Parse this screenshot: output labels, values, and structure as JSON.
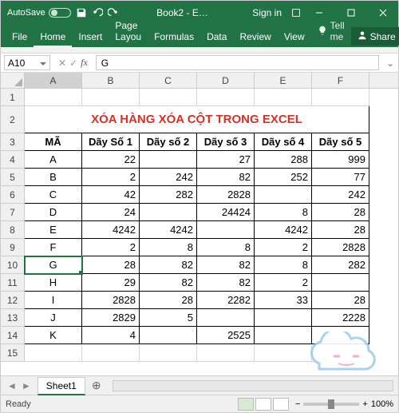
{
  "titlebar": {
    "autosave_label": "AutoSave",
    "autosave_state": "Off",
    "title": "Book2 - E…",
    "signin": "Sign in"
  },
  "ribbon": {
    "file": "File",
    "tabs": [
      "Home",
      "Insert",
      "Page Layou",
      "Formulas",
      "Data",
      "Review",
      "View"
    ],
    "tellme": "Tell me",
    "share": "Share"
  },
  "fx": {
    "namebox": "A10",
    "formula": "G"
  },
  "grid": {
    "cols": [
      "A",
      "B",
      "C",
      "D",
      "E",
      "F"
    ],
    "title": "XÓA HÀNG XÓA CỘT TRONG EXCEL",
    "headers": [
      "MÃ",
      "Dãy Số 1",
      "Dãy số 2",
      "Dãy số 3",
      "Dãy số 4",
      "Dãy số 5"
    ],
    "data": [
      [
        "A",
        "22",
        "",
        "27",
        "288",
        "999"
      ],
      [
        "B",
        "2",
        "242",
        "82",
        "252",
        "77"
      ],
      [
        "C",
        "42",
        "282",
        "2828",
        "",
        "242"
      ],
      [
        "D",
        "24",
        "",
        "24424",
        "8",
        "28"
      ],
      [
        "E",
        "4242",
        "4242",
        "",
        "4242",
        "28"
      ],
      [
        "F",
        "2",
        "8",
        "8",
        "2",
        "2828"
      ],
      [
        "G",
        "28",
        "82",
        "82",
        "8",
        "282"
      ],
      [
        "H",
        "29",
        "82",
        "82",
        "2",
        ""
      ],
      [
        "I",
        "2828",
        "28",
        "2282",
        "33",
        "28"
      ],
      [
        "J",
        "2829",
        "5",
        "",
        "",
        "2228"
      ],
      [
        "K",
        "4",
        "",
        "2525",
        "",
        ""
      ]
    ],
    "active_cell": "A10"
  },
  "sheet": {
    "name": "Sheet1"
  },
  "status": {
    "label": "Ready",
    "zoom": "100%"
  }
}
